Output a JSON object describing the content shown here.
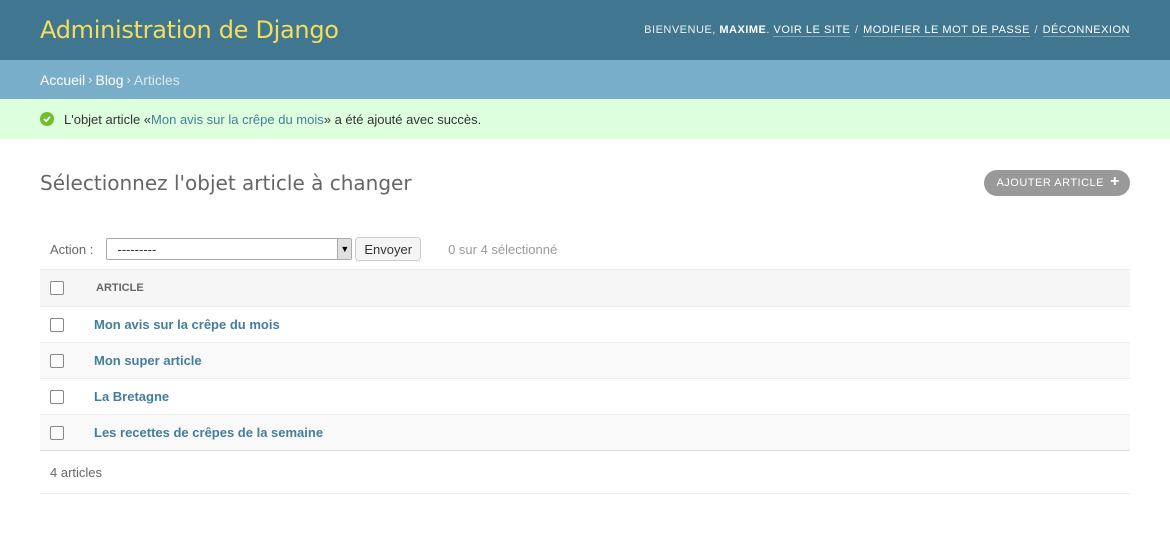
{
  "header": {
    "site_name": "Administration de Django",
    "welcome": "Bienvenue, ",
    "username": "Maxime",
    "welcome_suffix": ". ",
    "view_site": "Voir le site",
    "change_password": "Modifier le mot de passe",
    "logout": "Déconnexion",
    "separator": " / "
  },
  "breadcrumbs": {
    "home": "Accueil",
    "app": "Blog",
    "current": "Articles",
    "arrow": "›"
  },
  "message": {
    "prefix": "L'objet article « ",
    "link": "Mon avis sur la crêpe du mois",
    "suffix": " » a été ajouté avec succès."
  },
  "page": {
    "title": "Sélectionnez l'objet article à changer",
    "add_button": "Ajouter article",
    "add_icon": "+"
  },
  "actions": {
    "label": "Action :",
    "selected_option": "---------",
    "go_button": "Envoyer",
    "counter": "0 sur 4 sélectionné"
  },
  "table": {
    "column_header": "Article",
    "rows": [
      "Mon avis sur la crêpe du mois",
      "Mon super article",
      "La Bretagne",
      "Les recettes de crêpes de la semaine"
    ]
  },
  "paginator": {
    "count": "4 articles"
  },
  "colors": {
    "header_bg": "#417690",
    "site_name": "#f5dd5d",
    "breadcrumbs_bg": "#79aec8",
    "success_bg": "#dddddd",
    "success_icon": "#70bf2b",
    "link": "#447e9b"
  }
}
